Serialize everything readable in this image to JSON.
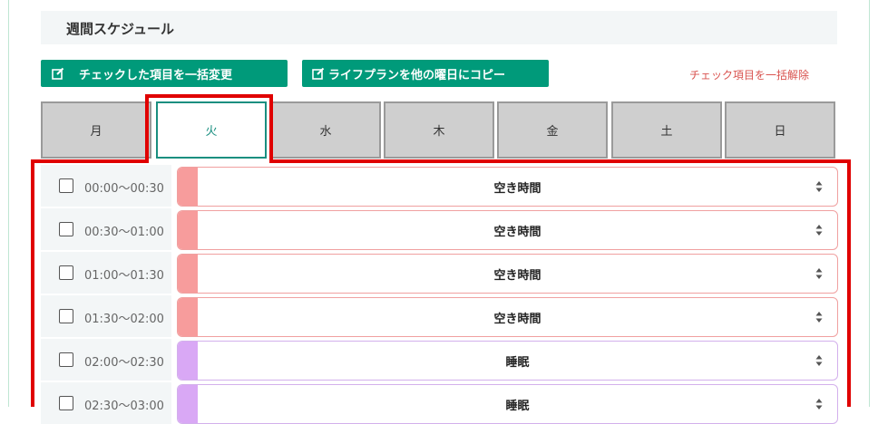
{
  "header": {
    "title": "週間スケジュール"
  },
  "toolbar": {
    "bulk_change_label": "チェックした項目を一括変更",
    "copy_lifeplan_label": "ライフプランを他の曜日にコピー",
    "uncheck_all_label": "チェック項目を一括解除"
  },
  "tabs": [
    {
      "label": "月",
      "active": false
    },
    {
      "label": "火",
      "active": true
    },
    {
      "label": "水",
      "active": false
    },
    {
      "label": "木",
      "active": false
    },
    {
      "label": "金",
      "active": false
    },
    {
      "label": "土",
      "active": false
    },
    {
      "label": "日",
      "active": false
    }
  ],
  "rows": [
    {
      "time": "00:00〜00:30",
      "value": "空き時間",
      "color": "#f79c9c",
      "border": "#f0a0a0"
    },
    {
      "time": "00:30〜01:00",
      "value": "空き時間",
      "color": "#f79c9c",
      "border": "#f0a0a0"
    },
    {
      "time": "01:00〜01:30",
      "value": "空き時間",
      "color": "#f79c9c",
      "border": "#f0a0a0"
    },
    {
      "time": "01:30〜02:00",
      "value": "空き時間",
      "color": "#f79c9c",
      "border": "#f0a0a0"
    },
    {
      "time": "02:00〜02:30",
      "value": "睡眠",
      "color": "#d9a8f5",
      "border": "#d3b0ec"
    },
    {
      "time": "02:30〜03:00",
      "value": "睡眠",
      "color": "#d9a8f5",
      "border": "#d3b0ec"
    }
  ],
  "colors": {
    "accent": "#009a7a",
    "highlight": "#e00000",
    "active_tab": "#1a8f80"
  }
}
